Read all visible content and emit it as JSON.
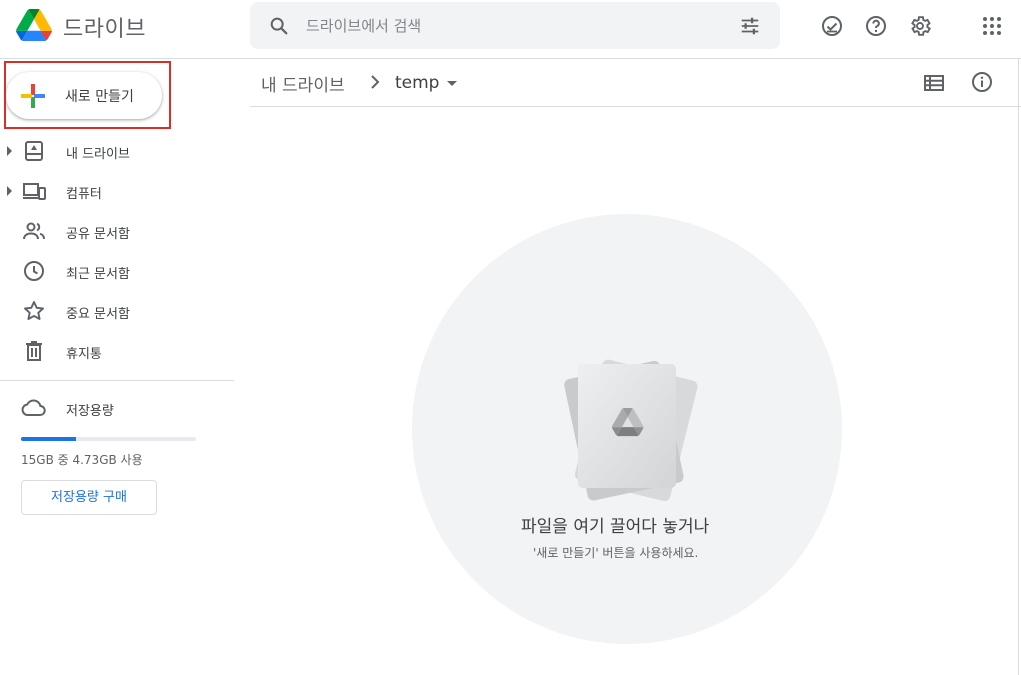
{
  "header": {
    "app_title": "드라이브",
    "search_placeholder": "드라이브에서 검색",
    "icons": [
      "drive-logo",
      "search-icon",
      "tune-icon",
      "offline-ready-icon",
      "help-icon",
      "settings-icon",
      "apps-grid-icon"
    ]
  },
  "sidebar": {
    "new_button_label": "새로 만들기",
    "items": [
      {
        "label": "내 드라이브",
        "icon": "my-drive-icon",
        "expandable": true
      },
      {
        "label": "컴퓨터",
        "icon": "computers-icon",
        "expandable": true
      },
      {
        "label": "공유 문서함",
        "icon": "shared-icon",
        "expandable": false
      },
      {
        "label": "최근 문서함",
        "icon": "recent-icon",
        "expandable": false
      },
      {
        "label": "중요 문서함",
        "icon": "starred-icon",
        "expandable": false
      },
      {
        "label": "휴지통",
        "icon": "trash-icon",
        "expandable": false
      }
    ],
    "storage": {
      "label": "저장용량",
      "usage_text": "15GB 중 4.73GB 사용",
      "used_fraction": 0.315,
      "buy_button_label": "저장용량 구매"
    }
  },
  "main": {
    "breadcrumb": {
      "root": "내 드라이브",
      "current": "temp"
    },
    "empty_state": {
      "title": "파일을 여기 끌어다 놓거나",
      "subtitle": "'새로 만들기' 버튼을 사용하세요."
    }
  },
  "colors": {
    "accent": "#1a73e8",
    "highlight": "#d93025",
    "search_bg": "#f1f3f4"
  }
}
